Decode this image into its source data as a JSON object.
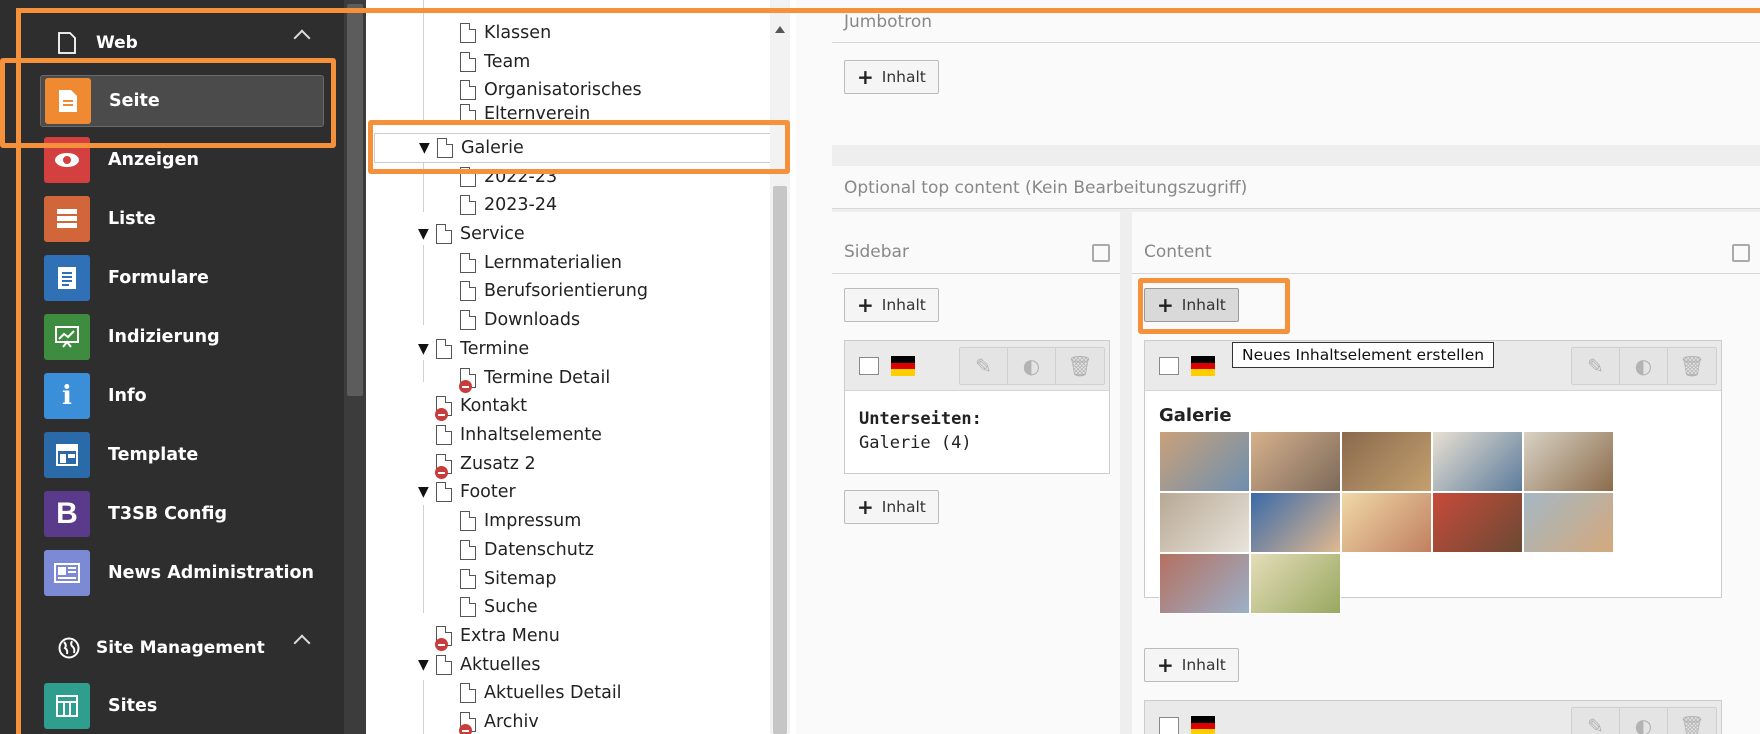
{
  "module_menu": {
    "groups": [
      {
        "label": "Web",
        "icon": "page-icon"
      },
      {
        "label": "Site Management",
        "icon": "globe-icon"
      }
    ],
    "modules": [
      {
        "label": "Seite",
        "icon": "page-module-icon",
        "color": "#f08a32",
        "glyph": "▤"
      },
      {
        "label": "Anzeigen",
        "icon": "eye-icon",
        "color": "#d44040",
        "glyph": "👁"
      },
      {
        "label": "Liste",
        "icon": "list-icon",
        "color": "#d0663a",
        "glyph": "☰"
      },
      {
        "label": "Formulare",
        "icon": "form-icon",
        "color": "#2f70b6",
        "glyph": "▦"
      },
      {
        "label": "Indizierung",
        "icon": "chart-icon",
        "color": "#3e8c40",
        "glyph": "⛰"
      },
      {
        "label": "Info",
        "icon": "info-icon",
        "color": "#3b8ed8",
        "glyph": "i"
      },
      {
        "label": "Template",
        "icon": "template-icon",
        "color": "#2a6aa8",
        "glyph": "▥"
      },
      {
        "label": "T3SB Config",
        "icon": "bootstrap-icon",
        "color": "#5a3a8a",
        "glyph": "B"
      },
      {
        "label": "News Administration",
        "icon": "newspaper-icon",
        "color": "#7c8ad6",
        "glyph": "▣"
      },
      {
        "label": "Sites",
        "icon": "sites-icon",
        "color": "#2f9e8e",
        "glyph": "▤"
      }
    ]
  },
  "page_tree": {
    "nodes": [
      {
        "label": "Klassen"
      },
      {
        "label": "Team"
      },
      {
        "label": "Organisatorisches"
      },
      {
        "label": "Elternverein"
      },
      {
        "label": "Galerie"
      },
      {
        "label": "2022-23"
      },
      {
        "label": "2023-24"
      },
      {
        "label": "Service"
      },
      {
        "label": "Lernmaterialien"
      },
      {
        "label": "Berufsorientierung"
      },
      {
        "label": "Downloads"
      },
      {
        "label": "Termine"
      },
      {
        "label": "Termine Detail"
      },
      {
        "label": "Kontakt"
      },
      {
        "label": "Inhaltselemente"
      },
      {
        "label": "Zusatz 2"
      },
      {
        "label": "Footer"
      },
      {
        "label": "Impressum"
      },
      {
        "label": "Datenschutz"
      },
      {
        "label": "Sitemap"
      },
      {
        "label": "Suche"
      },
      {
        "label": "Extra Menu"
      },
      {
        "label": "Aktuelles"
      },
      {
        "label": "Aktuelles Detail"
      },
      {
        "label": "Archiv"
      }
    ]
  },
  "content": {
    "jumbotron_title": "Jumbotron",
    "optional_top_title": "Optional top content (Kein Bearbeitungszugriff)",
    "sidebar_title": "Sidebar",
    "content_title": "Content",
    "add_label": "Inhalt",
    "tooltip": "Neues Inhaltselement erstellen",
    "sidebar_card": {
      "heading": "Unterseiten:",
      "text": "Galerie (4)"
    },
    "content_card": {
      "heading": "Galerie"
    },
    "language_flag": [
      "#000000",
      "#dd0000",
      "#ffce00"
    ],
    "highlight_color": "#f4913a"
  }
}
